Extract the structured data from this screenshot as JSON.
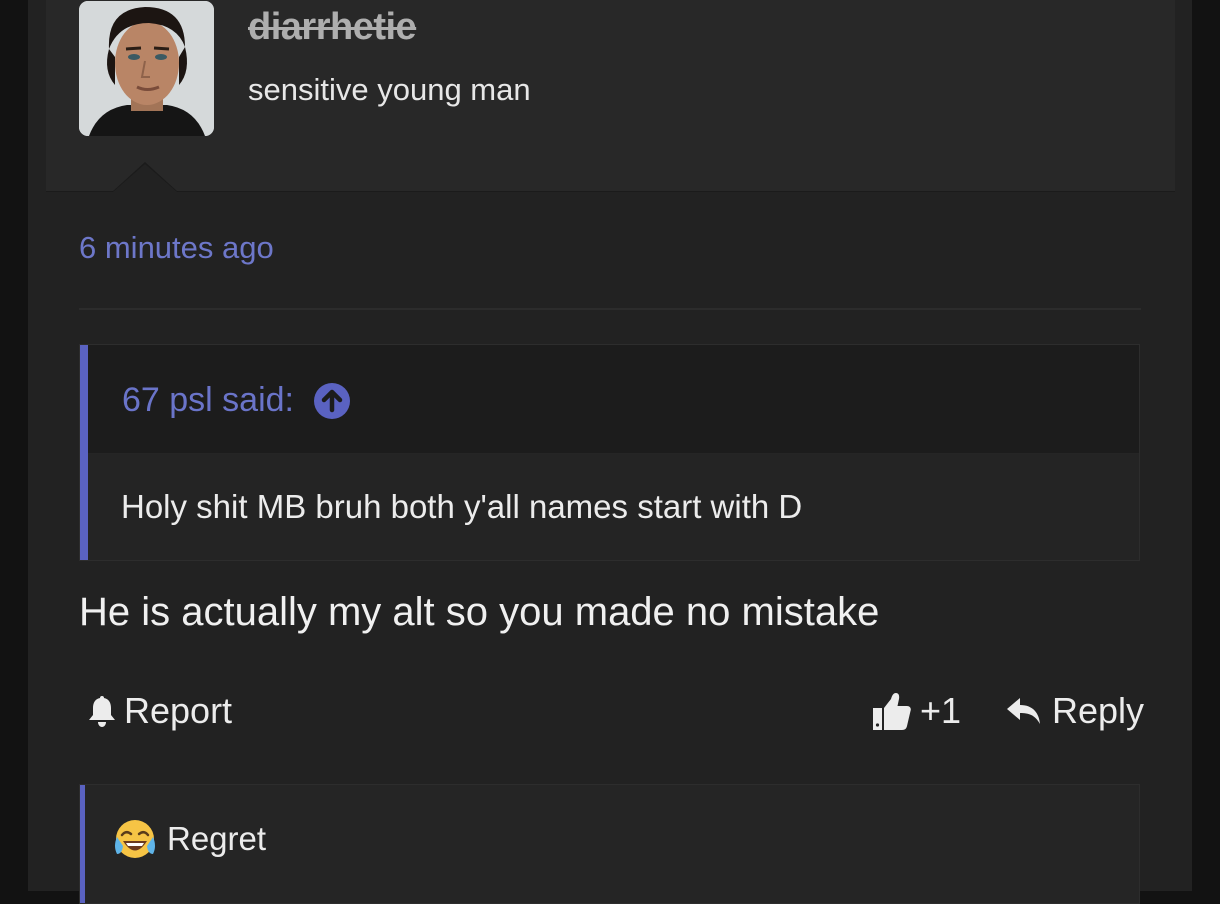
{
  "user": {
    "name": "diarrhetie",
    "title": "sensitive young man",
    "avatar_icon": "avatar-image"
  },
  "post": {
    "timestamp": "6 minutes ago",
    "body": "He is actually my alt so you made no mistake"
  },
  "quote": {
    "author": "67 psl said:",
    "text": "Holy shit MB bruh both y'all names start with D",
    "jump_icon": "arrow-up-circle-icon"
  },
  "actions": {
    "report_label": "Report",
    "like_count": "+1",
    "reply_label": "Reply"
  },
  "reaction": {
    "label": "Regret",
    "icon": "crying-laughing-emoji"
  },
  "colors": {
    "accent": "#5a62c1",
    "link": "#6d77c9",
    "background": "#222222"
  }
}
